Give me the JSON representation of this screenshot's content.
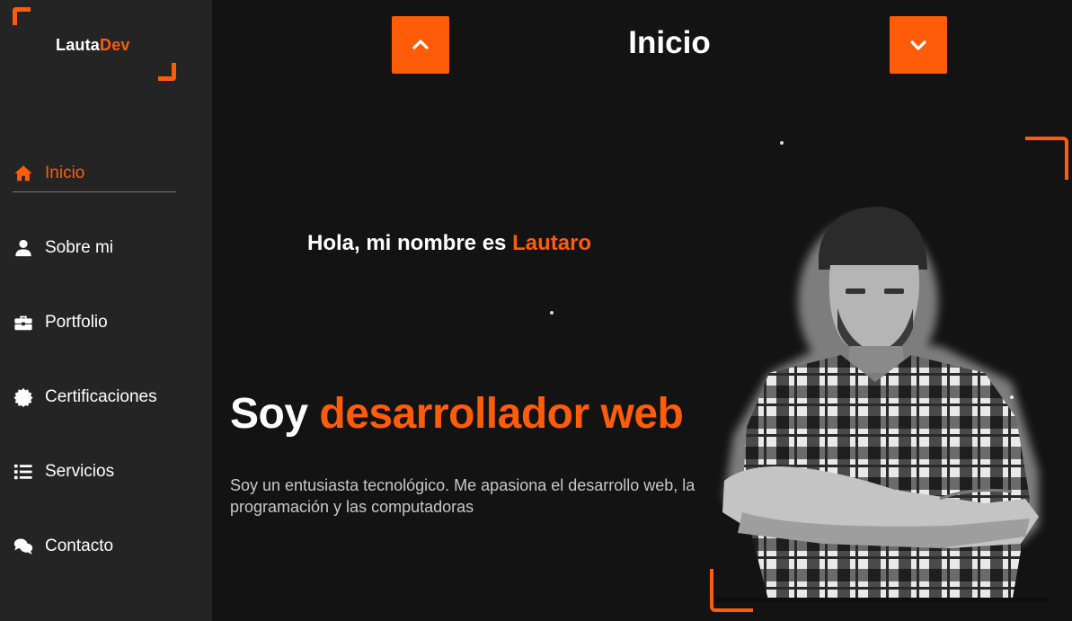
{
  "logo": {
    "part1": "Lauta",
    "part2": "Dev"
  },
  "nav": {
    "items": [
      {
        "label": "Inicio",
        "icon": "home-icon",
        "active": true
      },
      {
        "label": "Sobre mi",
        "icon": "user-icon"
      },
      {
        "label": "Portfolio",
        "icon": "briefcase-icon"
      },
      {
        "label": "Certificaciones",
        "icon": "certificate-icon"
      },
      {
        "label": "Servicios",
        "icon": "list-icon"
      },
      {
        "label": "Contacto",
        "icon": "comments-icon"
      }
    ]
  },
  "header": {
    "title": "Inicio",
    "up_icon": "chevron-up-icon",
    "down_icon": "chevron-down-icon"
  },
  "hero": {
    "greeting_prefix": "Hola, mi nombre es ",
    "greeting_name": "Lautaro",
    "headline_prefix": "Soy ",
    "headline_highlight": "desarrollador web",
    "description": "Soy un entusiasta tecnológico. Me apasiona el desarrollo web, la programación y las computadoras"
  },
  "colors": {
    "accent": "#ff5c0a",
    "sidebar": "#242424",
    "background": "#141314"
  }
}
